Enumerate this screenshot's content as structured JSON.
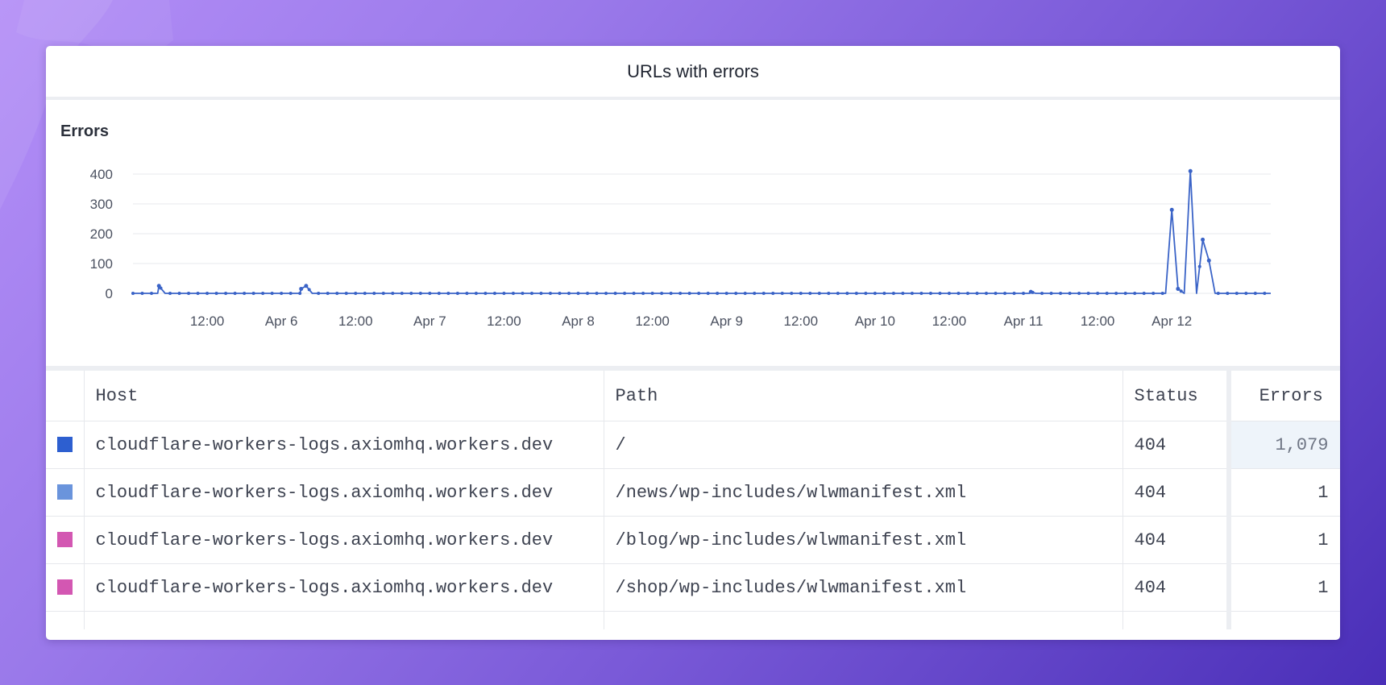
{
  "panel": {
    "title": "URLs with errors"
  },
  "chart_data": {
    "type": "line",
    "title": "Errors",
    "ylim": [
      0,
      400
    ],
    "y_ticks": [
      "400",
      "300",
      "200",
      "100",
      "0"
    ],
    "x_ticks": [
      "12:00",
      "Apr 6",
      "12:00",
      "Apr 7",
      "12:00",
      "Apr 8",
      "12:00",
      "Apr 9",
      "12:00",
      "Apr 10",
      "12:00",
      "Apr 11",
      "12:00",
      "Apr 12"
    ],
    "x_range_hours": [
      0,
      184
    ],
    "grid": true,
    "legend": "none",
    "color": "#3a63c7",
    "series": [
      {
        "points": [
          [
            0,
            0
          ],
          [
            4,
            0
          ],
          [
            4.2,
            25
          ],
          [
            5.2,
            0
          ],
          [
            20,
            0
          ],
          [
            27,
            0
          ],
          [
            27.2,
            15
          ],
          [
            28,
            25
          ],
          [
            29,
            0
          ],
          [
            47,
            0
          ],
          [
            130,
            0
          ],
          [
            145,
            0
          ],
          [
            145.2,
            5
          ],
          [
            146,
            0
          ],
          [
            165,
            0
          ],
          [
            167,
            0
          ],
          [
            168,
            280
          ],
          [
            169,
            15
          ],
          [
            170,
            0
          ],
          [
            171,
            410
          ],
          [
            172,
            0
          ],
          [
            173,
            180
          ],
          [
            174,
            110
          ],
          [
            175,
            0
          ],
          [
            184,
            0
          ]
        ]
      }
    ]
  },
  "table": {
    "columns": [
      "Host",
      "Path",
      "Status",
      "Errors"
    ],
    "rows": [
      {
        "host": "cloudflare-workers-logs.axiomhq.workers.dev",
        "path": "/",
        "status": "404",
        "errors": "1,079",
        "color": "#2d5fd0"
      },
      {
        "host": "cloudflare-workers-logs.axiomhq.workers.dev",
        "path": "/news/wp-includes/wlwmanifest.xml",
        "status": "404",
        "errors": "1",
        "color": "#6a94dc"
      },
      {
        "host": "cloudflare-workers-logs.axiomhq.workers.dev",
        "path": "/blog/wp-includes/wlwmanifest.xml",
        "status": "404",
        "errors": "1",
        "color": "#d357b2"
      },
      {
        "host": "cloudflare-workers-logs.axiomhq.workers.dev",
        "path": "/shop/wp-includes/wlwmanifest.xml",
        "status": "404",
        "errors": "1",
        "color": "#d357b2"
      }
    ]
  }
}
